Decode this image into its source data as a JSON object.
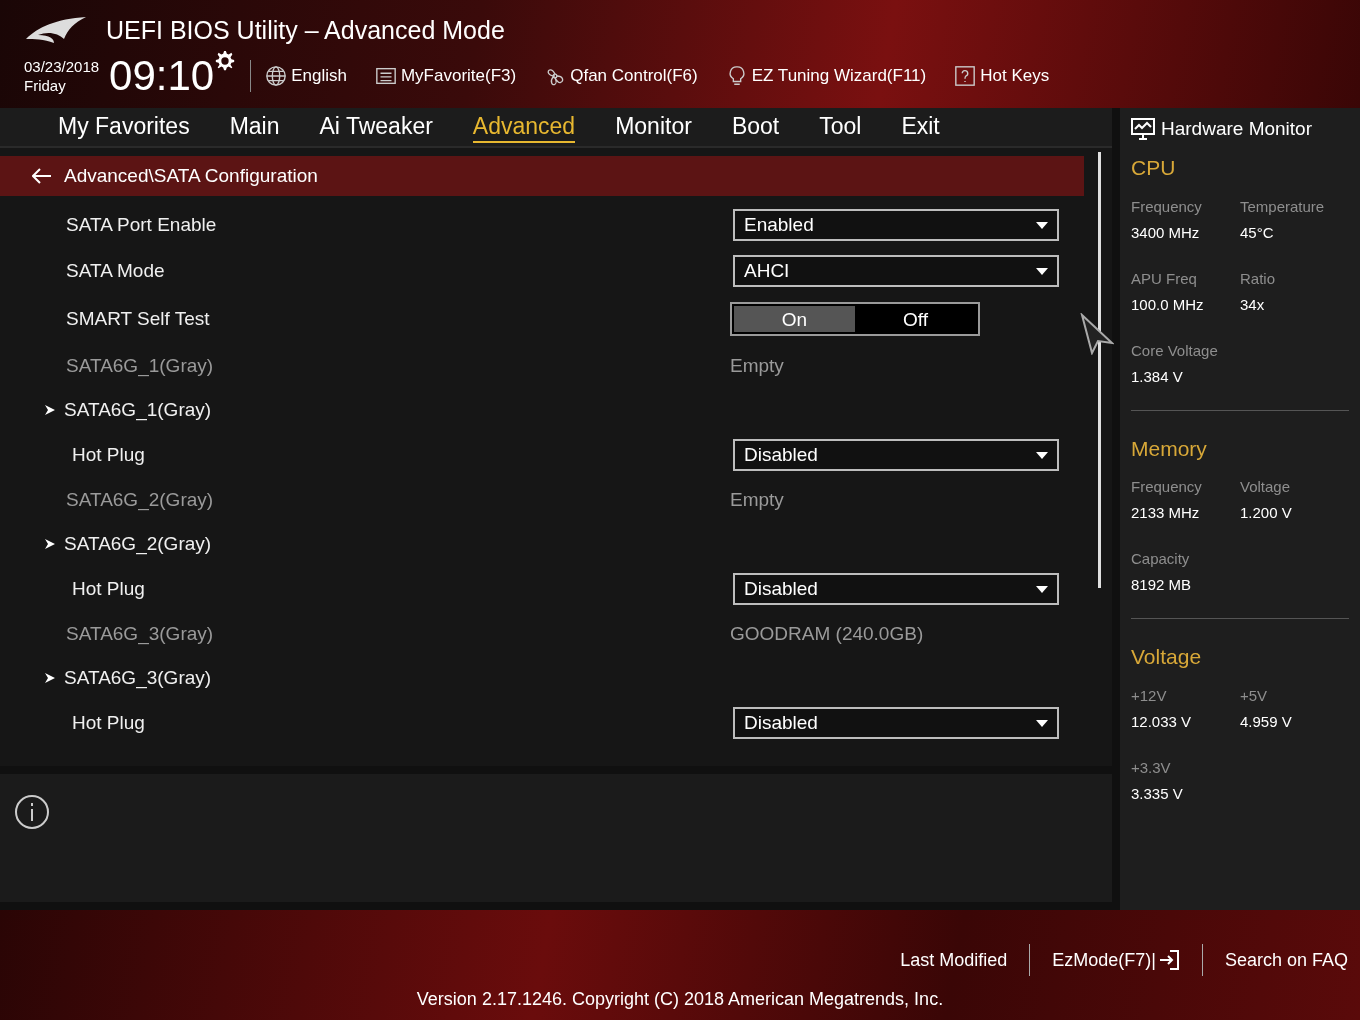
{
  "window": {
    "title": "UEFI BIOS Utility – Advanced Mode"
  },
  "clock": {
    "date": "03/23/2018",
    "day": "Friday",
    "time": "09:10"
  },
  "toolbar": [
    {
      "kind": "globe",
      "label": "English"
    },
    {
      "kind": "list",
      "label": "MyFavorite(F3)"
    },
    {
      "kind": "fan",
      "label": "Qfan Control(F6)"
    },
    {
      "kind": "bulb",
      "label": "EZ Tuning Wizard(F11)"
    },
    {
      "kind": "help",
      "label": "Hot Keys"
    }
  ],
  "tabs": [
    {
      "label": "My Favorites",
      "selected": false
    },
    {
      "label": "Main",
      "selected": false
    },
    {
      "label": "Ai Tweaker",
      "selected": false
    },
    {
      "label": "Advanced",
      "selected": true
    },
    {
      "label": "Monitor",
      "selected": false
    },
    {
      "label": "Boot",
      "selected": false
    },
    {
      "label": "Tool",
      "selected": false
    },
    {
      "label": "Exit",
      "selected": false
    }
  ],
  "breadcrumb": "Advanced\\SATA Configuration",
  "settings": [
    {
      "kind": "dropdown",
      "label": "SATA Port Enable",
      "value": "Enabled"
    },
    {
      "kind": "dropdown",
      "label": "SATA Mode",
      "value": "AHCI"
    },
    {
      "kind": "toggle",
      "label": "SMART Self Test",
      "options": [
        {
          "label": "On",
          "selected": true
        },
        {
          "label": "Off",
          "selected": false
        }
      ]
    },
    {
      "kind": "info",
      "label": "SATA6G_1(Gray)",
      "value": "Empty"
    },
    {
      "kind": "submenu",
      "label": "SATA6G_1(Gray)",
      "children": [
        {
          "kind": "dropdown",
          "label": "Hot Plug",
          "value": "Disabled"
        }
      ]
    },
    {
      "kind": "info",
      "label": "SATA6G_2(Gray)",
      "value": "Empty"
    },
    {
      "kind": "submenu",
      "label": "SATA6G_2(Gray)",
      "children": [
        {
          "kind": "dropdown",
          "label": "Hot Plug",
          "value": "Disabled"
        }
      ]
    },
    {
      "kind": "info",
      "label": "SATA6G_3(Gray)",
      "value": "GOODRAM (240.0GB)"
    },
    {
      "kind": "submenu",
      "label": "SATA6G_3(Gray)",
      "children": [
        {
          "kind": "dropdown",
          "label": "Hot Plug",
          "value": "Disabled"
        }
      ]
    }
  ],
  "hardware_monitor": {
    "title": "Hardware Monitor",
    "sections": [
      {
        "title": "CPU",
        "stats": [
          {
            "label": "Frequency",
            "value": "3400 MHz"
          },
          {
            "label": "Temperature",
            "value": "45°C"
          },
          {
            "label": "APU Freq",
            "value": "100.0 MHz"
          },
          {
            "label": "Ratio",
            "value": "34x"
          },
          {
            "label": "Core Voltage",
            "value": "1.384 V"
          }
        ]
      },
      {
        "title": "Memory",
        "stats": [
          {
            "label": "Frequency",
            "value": "2133 MHz"
          },
          {
            "label": "Voltage",
            "value": "1.200 V"
          },
          {
            "label": "Capacity",
            "value": "8192 MB"
          }
        ]
      },
      {
        "title": "Voltage",
        "stats": [
          {
            "label": "+12V",
            "value": "12.033 V"
          },
          {
            "label": "+5V",
            "value": "4.959 V"
          },
          {
            "label": "+3.3V",
            "value": "3.335 V"
          }
        ]
      }
    ]
  },
  "footer": {
    "buttons": [
      {
        "kind": "plain",
        "label": "Last Modified"
      },
      {
        "kind": "exit",
        "label": "EzMode(F7)|"
      },
      {
        "kind": "plain",
        "label": "Search on FAQ"
      }
    ],
    "version": "Version 2.17.1246. Copyright (C) 2018 American Megatrends, Inc."
  }
}
